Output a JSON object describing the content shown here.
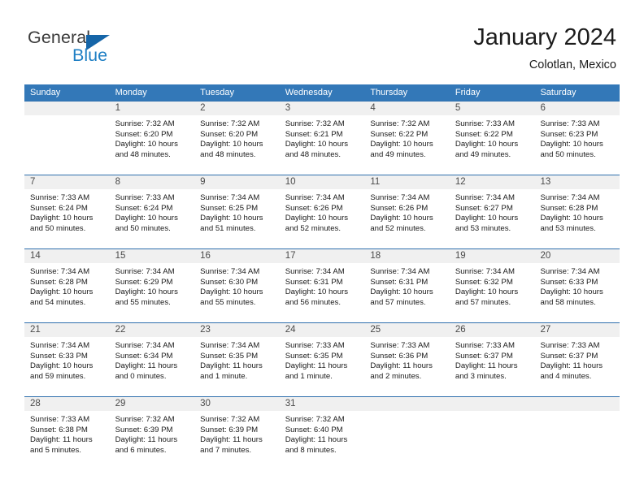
{
  "brand": {
    "name_part1": "General",
    "name_part2": "Blue",
    "triangle_color": "#1565a8",
    "blue_color": "#1f7fc4"
  },
  "header": {
    "title": "January 2024",
    "subtitle": "Colotlan, Mexico"
  },
  "theme": {
    "header_blue": "#3378b8",
    "row_divider_blue": "#2f6fad",
    "daynum_band": "#f0f0f0"
  },
  "weekdays": [
    "Sunday",
    "Monday",
    "Tuesday",
    "Wednesday",
    "Thursday",
    "Friday",
    "Saturday"
  ],
  "labels": {
    "sunrise_prefix": "Sunrise:",
    "sunset_prefix": "Sunset:",
    "daylight_prefix": "Daylight:"
  },
  "weeks": [
    [
      {
        "day": "",
        "sunrise": "",
        "sunset": "",
        "daylight_line1": "",
        "daylight_line2": ""
      },
      {
        "day": "1",
        "sunrise": "Sunrise: 7:32 AM",
        "sunset": "Sunset: 6:20 PM",
        "daylight_line1": "Daylight: 10 hours",
        "daylight_line2": "and 48 minutes."
      },
      {
        "day": "2",
        "sunrise": "Sunrise: 7:32 AM",
        "sunset": "Sunset: 6:20 PM",
        "daylight_line1": "Daylight: 10 hours",
        "daylight_line2": "and 48 minutes."
      },
      {
        "day": "3",
        "sunrise": "Sunrise: 7:32 AM",
        "sunset": "Sunset: 6:21 PM",
        "daylight_line1": "Daylight: 10 hours",
        "daylight_line2": "and 48 minutes."
      },
      {
        "day": "4",
        "sunrise": "Sunrise: 7:32 AM",
        "sunset": "Sunset: 6:22 PM",
        "daylight_line1": "Daylight: 10 hours",
        "daylight_line2": "and 49 minutes."
      },
      {
        "day": "5",
        "sunrise": "Sunrise: 7:33 AM",
        "sunset": "Sunset: 6:22 PM",
        "daylight_line1": "Daylight: 10 hours",
        "daylight_line2": "and 49 minutes."
      },
      {
        "day": "6",
        "sunrise": "Sunrise: 7:33 AM",
        "sunset": "Sunset: 6:23 PM",
        "daylight_line1": "Daylight: 10 hours",
        "daylight_line2": "and 50 minutes."
      }
    ],
    [
      {
        "day": "7",
        "sunrise": "Sunrise: 7:33 AM",
        "sunset": "Sunset: 6:24 PM",
        "daylight_line1": "Daylight: 10 hours",
        "daylight_line2": "and 50 minutes."
      },
      {
        "day": "8",
        "sunrise": "Sunrise: 7:33 AM",
        "sunset": "Sunset: 6:24 PM",
        "daylight_line1": "Daylight: 10 hours",
        "daylight_line2": "and 50 minutes."
      },
      {
        "day": "9",
        "sunrise": "Sunrise: 7:34 AM",
        "sunset": "Sunset: 6:25 PM",
        "daylight_line1": "Daylight: 10 hours",
        "daylight_line2": "and 51 minutes."
      },
      {
        "day": "10",
        "sunrise": "Sunrise: 7:34 AM",
        "sunset": "Sunset: 6:26 PM",
        "daylight_line1": "Daylight: 10 hours",
        "daylight_line2": "and 52 minutes."
      },
      {
        "day": "11",
        "sunrise": "Sunrise: 7:34 AM",
        "sunset": "Sunset: 6:26 PM",
        "daylight_line1": "Daylight: 10 hours",
        "daylight_line2": "and 52 minutes."
      },
      {
        "day": "12",
        "sunrise": "Sunrise: 7:34 AM",
        "sunset": "Sunset: 6:27 PM",
        "daylight_line1": "Daylight: 10 hours",
        "daylight_line2": "and 53 minutes."
      },
      {
        "day": "13",
        "sunrise": "Sunrise: 7:34 AM",
        "sunset": "Sunset: 6:28 PM",
        "daylight_line1": "Daylight: 10 hours",
        "daylight_line2": "and 53 minutes."
      }
    ],
    [
      {
        "day": "14",
        "sunrise": "Sunrise: 7:34 AM",
        "sunset": "Sunset: 6:28 PM",
        "daylight_line1": "Daylight: 10 hours",
        "daylight_line2": "and 54 minutes."
      },
      {
        "day": "15",
        "sunrise": "Sunrise: 7:34 AM",
        "sunset": "Sunset: 6:29 PM",
        "daylight_line1": "Daylight: 10 hours",
        "daylight_line2": "and 55 minutes."
      },
      {
        "day": "16",
        "sunrise": "Sunrise: 7:34 AM",
        "sunset": "Sunset: 6:30 PM",
        "daylight_line1": "Daylight: 10 hours",
        "daylight_line2": "and 55 minutes."
      },
      {
        "day": "17",
        "sunrise": "Sunrise: 7:34 AM",
        "sunset": "Sunset: 6:31 PM",
        "daylight_line1": "Daylight: 10 hours",
        "daylight_line2": "and 56 minutes."
      },
      {
        "day": "18",
        "sunrise": "Sunrise: 7:34 AM",
        "sunset": "Sunset: 6:31 PM",
        "daylight_line1": "Daylight: 10 hours",
        "daylight_line2": "and 57 minutes."
      },
      {
        "day": "19",
        "sunrise": "Sunrise: 7:34 AM",
        "sunset": "Sunset: 6:32 PM",
        "daylight_line1": "Daylight: 10 hours",
        "daylight_line2": "and 57 minutes."
      },
      {
        "day": "20",
        "sunrise": "Sunrise: 7:34 AM",
        "sunset": "Sunset: 6:33 PM",
        "daylight_line1": "Daylight: 10 hours",
        "daylight_line2": "and 58 minutes."
      }
    ],
    [
      {
        "day": "21",
        "sunrise": "Sunrise: 7:34 AM",
        "sunset": "Sunset: 6:33 PM",
        "daylight_line1": "Daylight: 10 hours",
        "daylight_line2": "and 59 minutes."
      },
      {
        "day": "22",
        "sunrise": "Sunrise: 7:34 AM",
        "sunset": "Sunset: 6:34 PM",
        "daylight_line1": "Daylight: 11 hours",
        "daylight_line2": "and 0 minutes."
      },
      {
        "day": "23",
        "sunrise": "Sunrise: 7:34 AM",
        "sunset": "Sunset: 6:35 PM",
        "daylight_line1": "Daylight: 11 hours",
        "daylight_line2": "and 1 minute."
      },
      {
        "day": "24",
        "sunrise": "Sunrise: 7:33 AM",
        "sunset": "Sunset: 6:35 PM",
        "daylight_line1": "Daylight: 11 hours",
        "daylight_line2": "and 1 minute."
      },
      {
        "day": "25",
        "sunrise": "Sunrise: 7:33 AM",
        "sunset": "Sunset: 6:36 PM",
        "daylight_line1": "Daylight: 11 hours",
        "daylight_line2": "and 2 minutes."
      },
      {
        "day": "26",
        "sunrise": "Sunrise: 7:33 AM",
        "sunset": "Sunset: 6:37 PM",
        "daylight_line1": "Daylight: 11 hours",
        "daylight_line2": "and 3 minutes."
      },
      {
        "day": "27",
        "sunrise": "Sunrise: 7:33 AM",
        "sunset": "Sunset: 6:37 PM",
        "daylight_line1": "Daylight: 11 hours",
        "daylight_line2": "and 4 minutes."
      }
    ],
    [
      {
        "day": "28",
        "sunrise": "Sunrise: 7:33 AM",
        "sunset": "Sunset: 6:38 PM",
        "daylight_line1": "Daylight: 11 hours",
        "daylight_line2": "and 5 minutes."
      },
      {
        "day": "29",
        "sunrise": "Sunrise: 7:32 AM",
        "sunset": "Sunset: 6:39 PM",
        "daylight_line1": "Daylight: 11 hours",
        "daylight_line2": "and 6 minutes."
      },
      {
        "day": "30",
        "sunrise": "Sunrise: 7:32 AM",
        "sunset": "Sunset: 6:39 PM",
        "daylight_line1": "Daylight: 11 hours",
        "daylight_line2": "and 7 minutes."
      },
      {
        "day": "31",
        "sunrise": "Sunrise: 7:32 AM",
        "sunset": "Sunset: 6:40 PM",
        "daylight_line1": "Daylight: 11 hours",
        "daylight_line2": "and 8 minutes."
      },
      {
        "day": "",
        "sunrise": "",
        "sunset": "",
        "daylight_line1": "",
        "daylight_line2": ""
      },
      {
        "day": "",
        "sunrise": "",
        "sunset": "",
        "daylight_line1": "",
        "daylight_line2": ""
      },
      {
        "day": "",
        "sunrise": "",
        "sunset": "",
        "daylight_line1": "",
        "daylight_line2": ""
      }
    ]
  ]
}
